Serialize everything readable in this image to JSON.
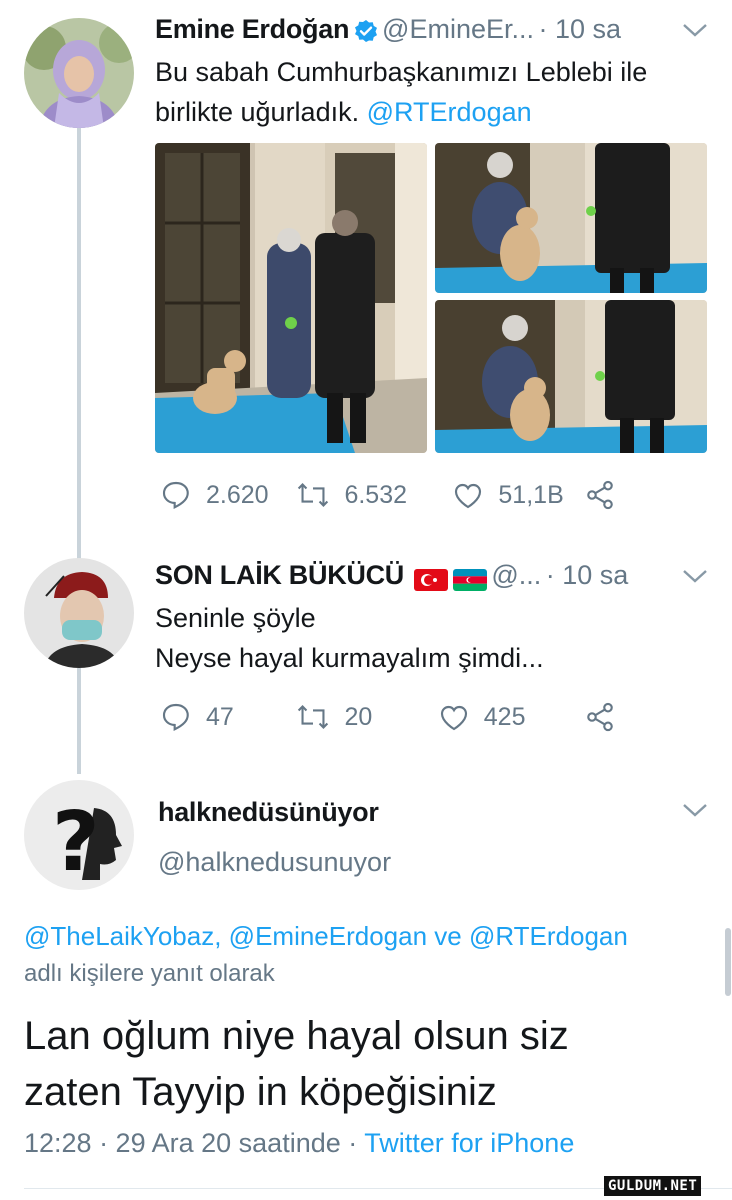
{
  "tweet1": {
    "display_name": "Emine Erdoğan",
    "handle": "@EmineEr...",
    "time": "· 10 sa",
    "text_line1": "Bu sabah Cumhurbaşkanımızı Leblebi ile",
    "text_line2": "birlikte uğurladık.",
    "mention": "@RTErdogan",
    "replies": "2.620",
    "retweets": "6.532",
    "likes": "51,1B"
  },
  "tweet2": {
    "display_name": "SON LAİK BÜKÜCÜ",
    "handle": "@...",
    "time": "· 10 sa",
    "text_line1": "Seninle şöyle",
    "text_line2": "Neyse hayal kurmayalım şimdi...",
    "replies": "47",
    "retweets": "20",
    "likes": "425"
  },
  "tweet3": {
    "display_name": "halknedüsünüyor",
    "handle": "@halknedusunuyor",
    "reply_mentions": "@TheLaikYobaz, @EmineErdogan ve @RTErdogan",
    "reply_suffix": "adlı kişilere yanıt olarak",
    "text_line1": "Lan oğlum niye hayal olsun siz",
    "text_line2": "zaten Tayyip in köpeğisiniz",
    "timestamp": "12:28 · 29 Ara 20 saatinde ·",
    "source": "Twitter for iPhone"
  },
  "watermark": "GULDUM.NET",
  "colors": {
    "accent": "#1da1f2",
    "secondary_text": "#657786",
    "thread_line": "#c9d3da"
  }
}
